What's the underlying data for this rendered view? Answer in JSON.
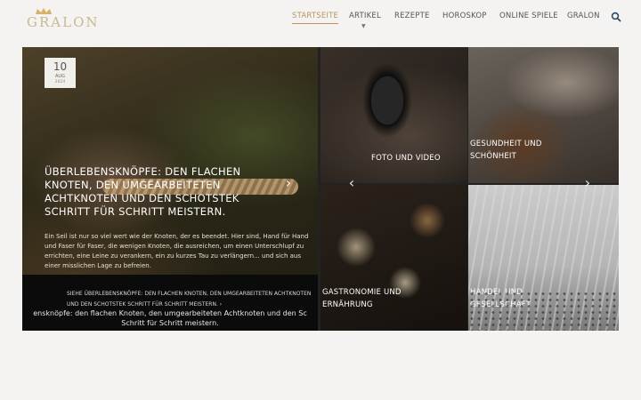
{
  "logo": {
    "text": "GRALON"
  },
  "nav": {
    "items": [
      {
        "label": "STARTSEITE",
        "active": true
      },
      {
        "label": "ARTIKEL",
        "has_dropdown": true
      },
      {
        "label": "REZEPTE"
      },
      {
        "label": "HOROSKOP"
      },
      {
        "label": "ONLINE SPIELE"
      },
      {
        "label": "GRALON"
      }
    ],
    "search_icon": "search-icon"
  },
  "hero": {
    "date": {
      "day": "10",
      "month": "AUG",
      "year": "2024"
    },
    "title": "Überlebensknöpfe: den flachen Knoten, den umgearbeiteten Achtknoten und den Schotstek Schritt für Schritt meistern.",
    "excerpt": "Ein Seil ist nur so viel wert wie der Knoten, der es beendet. Hier sind, Hand für Hand und Faser für Faser, die wenigen Knoten, die ausreichen, um einen Unterschlupf zu errichten, eine Leine zu verankern, ein zu kurzes Tau zu verlängern... und sich aus einer misslichen Lage zu befreien.",
    "link_label": "SIEHE ÜBERLEBENSKNÖPFE: DEN FLACHEN KNOTEN, DEN UMGEARBEITETEN ACHTKNOTEN UND DEN SCHOTSTEK SCHRITT FÜR SCHRITT MEISTERN.",
    "link_arrow": "›",
    "alt_text": "ensknöpfe: den flachen Knoten, den umgearbeiteten Achtknoten und den Sc",
    "alt_text_2": "Schritt für Schritt meistern."
  },
  "tiles": [
    {
      "label": "FOTO UND VIDEO"
    },
    {
      "label": "GESUNDHEIT UND SCHÖNHEIT"
    },
    {
      "label": "GASTRONOMIE UND ERNÄHRUNG"
    },
    {
      "label": "HANDEL UND GESELLSCHAFT"
    }
  ],
  "arrows": {
    "prev": "‹",
    "next": "›"
  },
  "colors": {
    "accent": "#b9945a",
    "background": "#f4f3f1",
    "logo": "#c9b98f"
  }
}
